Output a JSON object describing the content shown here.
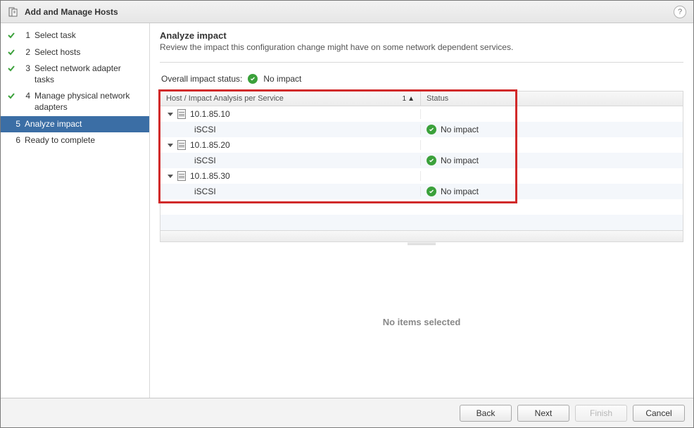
{
  "title": "Add and Manage Hosts",
  "steps": [
    {
      "num": "1",
      "label": "Select task",
      "state": "completed"
    },
    {
      "num": "2",
      "label": "Select hosts",
      "state": "completed"
    },
    {
      "num": "3",
      "label": "Select network adapter tasks",
      "state": "completed"
    },
    {
      "num": "4",
      "label": "Manage physical network adapters",
      "state": "completed"
    },
    {
      "num": "5",
      "label": "Analyze impact",
      "state": "current"
    },
    {
      "num": "6",
      "label": "Ready to complete",
      "state": "upcoming"
    }
  ],
  "header": {
    "title": "Analyze impact",
    "subtitle": "Review the impact this configuration change might have on some network dependent services."
  },
  "overall": {
    "label": "Overall impact status:",
    "value": "No impact"
  },
  "table": {
    "col_host": "Host / Impact Analysis per Service",
    "col_status": "Status",
    "sort_index": "1",
    "rows": [
      {
        "type": "host",
        "label": "10.1.85.10"
      },
      {
        "type": "service",
        "label": "iSCSI",
        "status": "No impact"
      },
      {
        "type": "host",
        "label": "10.1.85.20"
      },
      {
        "type": "service",
        "label": "iSCSI",
        "status": "No impact"
      },
      {
        "type": "host",
        "label": "10.1.85.30"
      },
      {
        "type": "service",
        "label": "iSCSI",
        "status": "No impact"
      }
    ]
  },
  "noitems": "No items selected",
  "buttons": {
    "back": "Back",
    "next": "Next",
    "finish": "Finish",
    "cancel": "Cancel"
  }
}
